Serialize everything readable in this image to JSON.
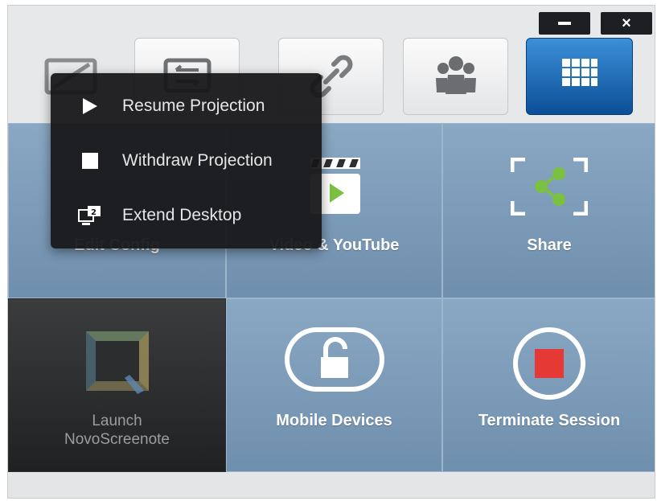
{
  "window": {
    "minimize_label": "",
    "close_label": "×"
  },
  "toolbar": {
    "tabs": [
      {
        "icon": "screen-project-icon"
      },
      {
        "icon": "switch-screen-icon"
      },
      {
        "icon": "link-icon"
      },
      {
        "icon": "group-icon"
      },
      {
        "icon": "grid-menu-icon",
        "active": true
      }
    ],
    "active_color": "#1565b0"
  },
  "context_menu": {
    "items": [
      {
        "label": "Resume Projection",
        "icon": "play-icon"
      },
      {
        "label": "Withdraw Projection",
        "icon": "stop-icon"
      },
      {
        "label": "Extend Desktop",
        "icon": "extend-desktop-icon"
      }
    ]
  },
  "tiles": {
    "edit_config": {
      "label": "Edit Config",
      "visible_label": "Edit Config"
    },
    "video_youtube": {
      "label": "Video & YouTube"
    },
    "share": {
      "label": "Share",
      "icon": "share-icon",
      "accent": "#7ac142"
    },
    "launch": {
      "label_line1": "Launch",
      "label_line2": "NovoScreenote",
      "icon": "novoscreenote-logo"
    },
    "mobile_devices": {
      "label": "Mobile Devices",
      "icon": "unlock-icon"
    },
    "terminate": {
      "label": "Terminate Session",
      "icon": "stop-session-icon",
      "accent": "#e53935"
    }
  }
}
